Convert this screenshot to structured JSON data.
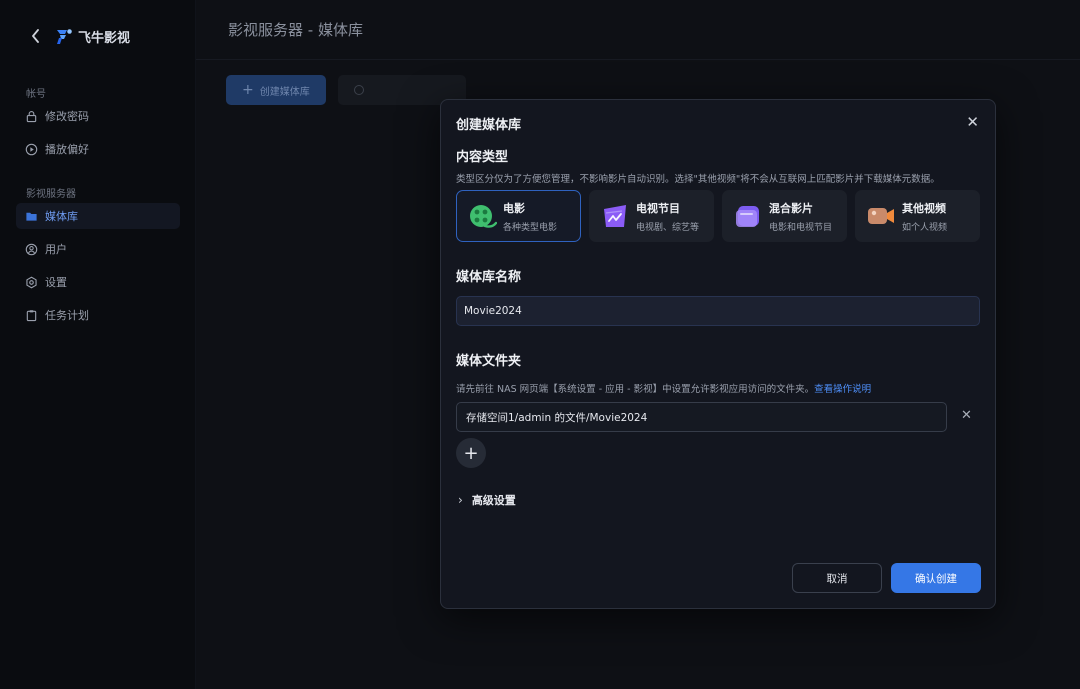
{
  "brand": {
    "name": "飞牛影视"
  },
  "sidebar": {
    "account_label": "帐号",
    "account_items": [
      {
        "label": "修改密码",
        "icon": "lock-icon"
      },
      {
        "label": "播放偏好",
        "icon": "play-circle-icon"
      }
    ],
    "server_label": "影视服务器",
    "server_items": [
      {
        "label": "媒体库",
        "icon": "folder-icon",
        "active": true
      },
      {
        "label": "用户",
        "icon": "user-icon"
      },
      {
        "label": "设置",
        "icon": "gear-icon"
      },
      {
        "label": "任务计划",
        "icon": "clipboard-icon"
      }
    ]
  },
  "main": {
    "title": "影视服务器 - 媒体库",
    "create_button": "创建媒体库"
  },
  "dialog": {
    "title": "创建媒体库",
    "content_type_heading": "内容类型",
    "content_type_hint": "类型区分仅为了方便您管理，不影响影片自动识别。选择\"其他视频\"将不会从互联网上匹配影片并下载媒体元数据。",
    "types": [
      {
        "name": "电影",
        "desc": "各种类型电影",
        "icon": "movie-reel-icon",
        "selected": true
      },
      {
        "name": "电视节目",
        "desc": "电视剧、综艺等",
        "icon": "tv-icon"
      },
      {
        "name": "混合影片",
        "desc": "电影和电视节目",
        "icon": "mixed-media-icon"
      },
      {
        "name": "其他视频",
        "desc": "如个人视频",
        "icon": "video-camera-icon"
      }
    ],
    "name_heading": "媒体库名称",
    "name_value": "Movie2024",
    "folder_heading": "媒体文件夹",
    "folder_hint": "请先前往 NAS 网页端【系统设置 - 应用 - 影视】中设置允许影视应用访问的文件夹。",
    "folder_hint_link": "查看操作说明",
    "folder_path": "存储空间1/admin 的文件/Movie2024",
    "advanced_label": "高级设置",
    "cancel_label": "取消",
    "confirm_label": "确认创建"
  },
  "colors": {
    "accent": "#3577e6",
    "link": "#4e8ef7",
    "active_nav": "#6f9cf2"
  }
}
